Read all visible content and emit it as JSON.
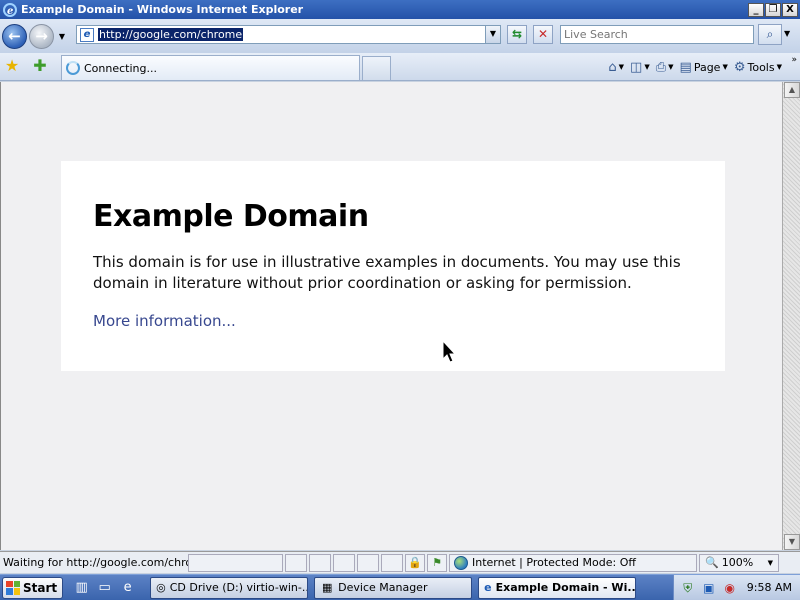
{
  "window": {
    "title": "Example Domain - Windows Internet Explorer",
    "buttons": {
      "minimize": "_",
      "maximize": "❐",
      "close": "X"
    }
  },
  "address_bar": {
    "url": "http://google.com/chrome",
    "search_placeholder": "Live Search",
    "refresh_glyph": "⇆",
    "stop_glyph": "✕",
    "search_glyph": "⌕"
  },
  "tab": {
    "label": "Connecting..."
  },
  "command_bar": {
    "home_icon": "home-icon",
    "feeds_icon": "feeds-icon",
    "print_icon": "print-icon",
    "page_label": "Page",
    "tools_label": "Tools"
  },
  "page": {
    "heading": "Example Domain",
    "body": "This domain is for use in illustrative examples in documents. You may use this domain in literature without prior coordination or asking for permission.",
    "link": "More information..."
  },
  "status_bar": {
    "text": "Waiting for http://google.com/chrome",
    "zone": "Internet | Protected Mode: Off",
    "zoom": "100%"
  },
  "taskbar": {
    "start_label": "Start",
    "tasks": [
      {
        "label": "CD Drive (D:) virtio-win-...",
        "active": false
      },
      {
        "label": "Device Manager",
        "active": false
      },
      {
        "label": "Example Domain - Wi...",
        "active": true
      }
    ],
    "clock": "9:58 AM"
  },
  "colors": {
    "title_bar": "#2452a8",
    "link": "#38488f",
    "content_background": "#f0f0f2",
    "card_background": "#ffffff",
    "taskbar": "#3a64ad"
  }
}
